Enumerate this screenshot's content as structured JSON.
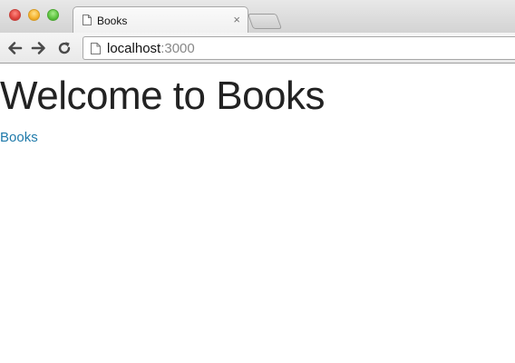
{
  "browser": {
    "tab": {
      "title": "Books",
      "close_glyph": "×"
    },
    "icons": {
      "tab_page": "page-icon",
      "back": "back-arrow-icon",
      "forward": "forward-arrow-icon",
      "reload": "reload-icon",
      "omnibox_page": "page-icon"
    },
    "address_bar": {
      "host": "localhost",
      "port": ":3000"
    }
  },
  "page": {
    "heading": "Welcome to Books",
    "link_text": "Books"
  },
  "colors": {
    "link": "#1f7aaa",
    "heading": "#222222"
  }
}
